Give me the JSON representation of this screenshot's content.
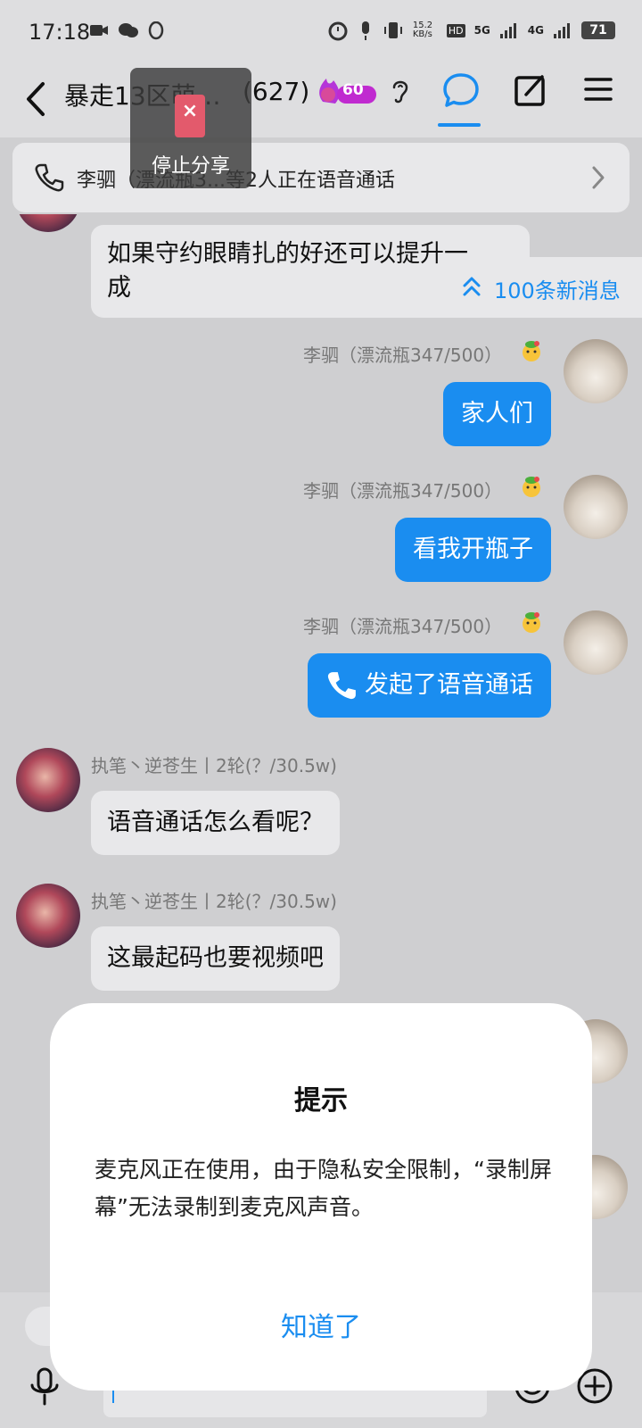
{
  "status_bar": {
    "time": "17:18",
    "net_speed": "15.2\nKB/s",
    "hd": "HD",
    "network_5g": "5G",
    "network_4g": "4G",
    "battery": "71"
  },
  "header": {
    "title": "暴走13区萌…",
    "member_count": "(627)",
    "fire_badge": "60"
  },
  "screen_share": {
    "label": "停止分享"
  },
  "call_banner": {
    "text": "李驷（漂流瓶3...等2人正在语音通话"
  },
  "new_messages": {
    "label": "100条新消息"
  },
  "messages": [
    {
      "side": "left",
      "text": "如果守约眼睛扎的好还可以提升一\n成"
    },
    {
      "side": "right",
      "sender": "李驷（漂流瓶347/500）",
      "text": "家人们"
    },
    {
      "side": "right",
      "sender": "李驷（漂流瓶347/500）",
      "text": "看我开瓶子"
    },
    {
      "side": "right",
      "sender": "李驷（漂流瓶347/500）",
      "text": "发起了语音通话"
    },
    {
      "side": "left",
      "sender": "执笔丶逆苍生丨2轮(？/30.5w)",
      "text": "语音通话怎么看呢？"
    },
    {
      "side": "left",
      "sender": "执笔丶逆苍生丨2轮(？/30.5w)",
      "text": "这最起码也要视频吧"
    }
  ],
  "dialog": {
    "title": "提示",
    "message": "麦克风正在使用，由于隐私安全限制，“录制屏幕”无法录制到麦克风声音。",
    "button": "知道了"
  },
  "colors": {
    "accent": "#1a8df0",
    "background": "#cfcfd1",
    "bubble_left": "#e8e8ea"
  }
}
